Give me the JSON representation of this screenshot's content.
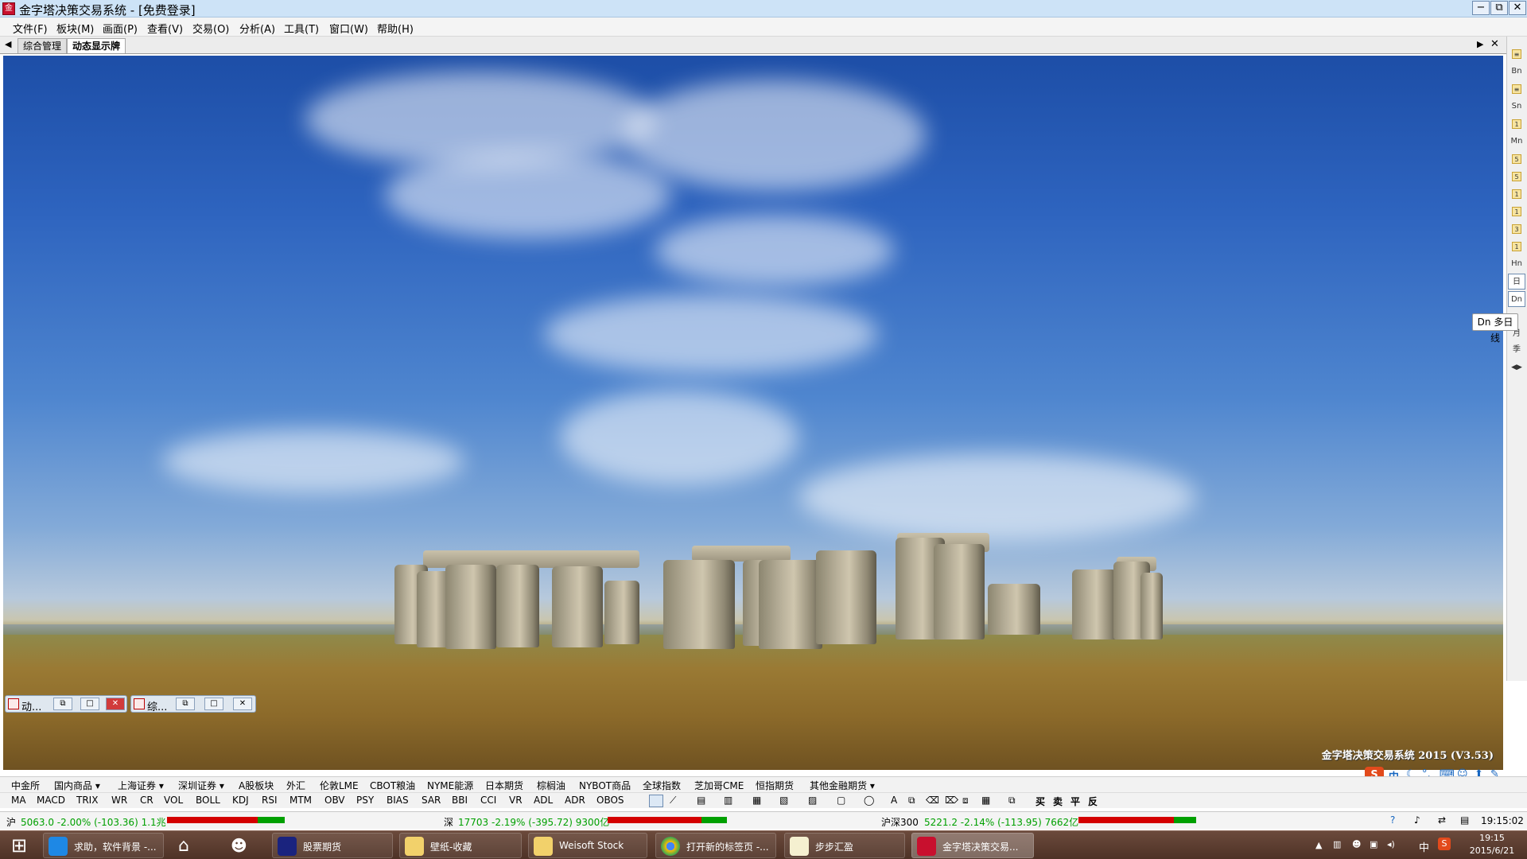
{
  "window": {
    "title": "金字塔决策交易系统 - [免费登录]",
    "app_icon": "app-logo-icon",
    "minimize": "−",
    "restore": "⧉",
    "close": "✕"
  },
  "menu": [
    "文件(F)",
    "板块(M)",
    "画面(P)",
    "查看(V)",
    "交易(O)",
    "分析(A)",
    "工具(T)",
    "窗口(W)",
    "帮助(H)"
  ],
  "tabs": [
    "综合管理",
    "动态显示牌"
  ],
  "watermark": "金字塔决策交易系统 2015 (V3.53)",
  "tooltip": "Dn 多日线",
  "right_toolbar": [
    "Bn",
    "Sn",
    "Mn",
    "Hn",
    "日",
    "Dn",
    "月",
    "季"
  ],
  "mini_windows": [
    {
      "label": "动..."
    },
    {
      "label": "综..."
    }
  ],
  "category_bar": [
    "中金所",
    "国内商品 ▾",
    "上海证券 ▾",
    "深圳证券 ▾",
    "A股板块",
    "外汇",
    "伦敦LME",
    "CBOT粮油",
    "NYME能源",
    "日本期货",
    "棕榈油",
    "NYBOT商品",
    "全球指数",
    "芝加哥CME",
    "恒指期货",
    "其他金融期货 ▾"
  ],
  "indicator_bar": [
    "MA",
    "MACD",
    "TRIX",
    "WR",
    "CR",
    "VOL",
    "BOLL",
    "KDJ",
    "RSI",
    "MTM",
    "OBV",
    "PSY",
    "BIAS",
    "SAR",
    "BBI",
    "CCI",
    "VR",
    "ADL",
    "ADR",
    "OBOS"
  ],
  "trade_buttons": [
    "买",
    "卖",
    "平",
    "反"
  ],
  "status": {
    "sh_label": "沪",
    "sh_value": "5063.0 -2.00% (-103.36) 1.1兆",
    "sz_label": "深",
    "sz_value": "17703 -2.19% (-395.72) 9300亿",
    "hs300_label": "沪深300",
    "hs300_value": "5221.2 -2.14% (-113.95) 7662亿",
    "time": "19:15:02"
  },
  "taskbar": {
    "items": [
      "求助，软件背景 -...",
      "股票期货",
      "壁纸-收藏",
      "Weisoft Stock",
      "打开新的标签页 -...",
      "步步汇盈",
      "金字塔决策交易..."
    ],
    "clock_time": "19:15",
    "clock_date": "2015/6/21",
    "ime_label": "中"
  },
  "colors": {
    "rise": "#d40000",
    "fall": "#00a000",
    "taskbar": "#5a3b2e"
  }
}
